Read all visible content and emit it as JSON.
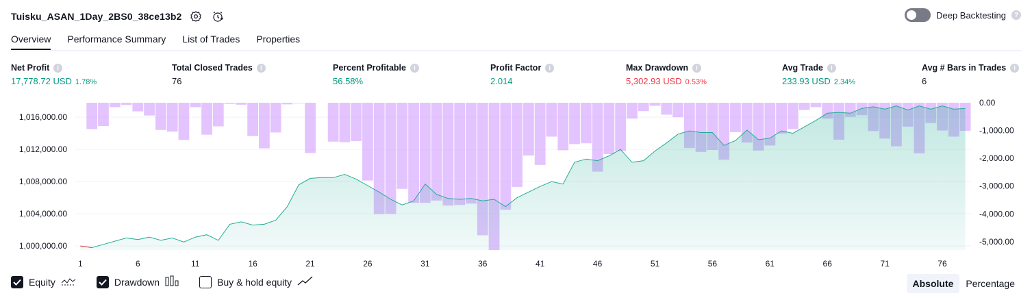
{
  "header": {
    "title": "Tuisku_ASAN_1Day_2BS0_38ce13b2",
    "settings_icon": "gear-icon",
    "alert_icon": "alarm-clock-icon"
  },
  "deep_backtesting": {
    "label": "Deep Backtesting",
    "enabled": false,
    "help": "?"
  },
  "tabs": [
    {
      "label": "Overview",
      "active": true
    },
    {
      "label": "Performance Summary",
      "active": false
    },
    {
      "label": "List of Trades",
      "active": false
    },
    {
      "label": "Properties",
      "active": false
    }
  ],
  "metrics": [
    {
      "label": "Net Profit",
      "value": "17,778.72 USD",
      "pct": "1.78%",
      "color": "#089981"
    },
    {
      "label": "Total Closed Trades",
      "value": "76",
      "pct": "",
      "color": "#131722"
    },
    {
      "label": "Percent Profitable",
      "value": "56.58%",
      "pct": "",
      "color": "#089981"
    },
    {
      "label": "Profit Factor",
      "value": "2.014",
      "pct": "",
      "color": "#089981"
    },
    {
      "label": "Max Drawdown",
      "value": "5,302.93 USD",
      "pct": "0.53%",
      "color": "#f23645"
    },
    {
      "label": "Avg Trade",
      "value": "233.93 USD",
      "pct": "2.34%",
      "color": "#089981"
    },
    {
      "label": "Avg # Bars in Trades",
      "value": "6",
      "pct": "",
      "color": "#131722"
    }
  ],
  "chart_data": {
    "type": "area",
    "x_ticks": [
      1,
      6,
      11,
      16,
      21,
      26,
      31,
      36,
      41,
      46,
      51,
      56,
      61,
      66,
      71,
      76
    ],
    "y_left_ticks": [
      "1,000,000.00",
      "1,004,000.00",
      "1,008,000.00",
      "1,012,000.00",
      "1,016,000.00"
    ],
    "y_left_values": [
      1000000,
      1004000,
      1008000,
      1012000,
      1016000
    ],
    "y_right_ticks": [
      "0.00",
      "-1,000.00",
      "-2,000.00",
      "-3,000.00",
      "-4,000.00",
      "-5,000.00"
    ],
    "y_right_values": [
      0,
      -1000,
      -2000,
      -3000,
      -4000,
      -5000
    ],
    "ylim_left": [
      999500,
      1017800
    ],
    "ylim_right": [
      -5300,
      0
    ],
    "equity": [
      1000000,
      999800,
      1000200,
      1000600,
      1001000,
      1000800,
      1001100,
      1000700,
      1001000,
      1000500,
      1001100,
      1001400,
      1000700,
      1002700,
      1003000,
      1002600,
      1002700,
      1003200,
      1004900,
      1007600,
      1008400,
      1008500,
      1008500,
      1008900,
      1008300,
      1007500,
      1006700,
      1005800,
      1005100,
      1005600,
      1007700,
      1006400,
      1005900,
      1005800,
      1005900,
      1005600,
      1005800,
      1004900,
      1006000,
      1006700,
      1007400,
      1008000,
      1007700,
      1010400,
      1010800,
      1010600,
      1011200,
      1012000,
      1010400,
      1010600,
      1011800,
      1012800,
      1013900,
      1014300,
      1014100,
      1014100,
      1012500,
      1013100,
      1014400,
      1013200,
      1013400,
      1014300,
      1014000,
      1014800,
      1015600,
      1016500,
      1016600,
      1016500,
      1017100,
      1017300,
      1017000,
      1017400,
      1016900,
      1017400,
      1017000,
      1017400,
      1017000,
      1017100
    ],
    "drawdown": [
      0,
      -950,
      -840,
      -160,
      -80,
      -310,
      -460,
      -980,
      -1040,
      -1340,
      -160,
      -1150,
      -850,
      -40,
      -70,
      -1200,
      -1640,
      -1070,
      -60,
      -20,
      -1810,
      0,
      -1400,
      -1420,
      -1380,
      -2800,
      -4010,
      -4000,
      -3100,
      -3600,
      -3600,
      -3520,
      -3700,
      -3680,
      -3630,
      -4770,
      -5300,
      -3850,
      -3030,
      -1900,
      -2240,
      -1220,
      -1710,
      -1490,
      -1460,
      -2480,
      -1850,
      -1740,
      -570,
      -300,
      -110,
      -430,
      -520,
      -1630,
      -1770,
      -1700,
      -2050,
      -1060,
      -1430,
      -1720,
      -1540,
      -1110,
      -950,
      -260,
      -160,
      -570,
      -1330,
      -510,
      -450,
      -1020,
      -1290,
      -1570,
      -860,
      -1820,
      -730,
      -1000,
      -1220,
      -1010
    ]
  },
  "legend": {
    "equity": {
      "label": "Equity",
      "checked": true
    },
    "drawdown": {
      "label": "Drawdown",
      "checked": true
    },
    "buy_hold": {
      "label": "Buy & hold equity",
      "checked": false
    }
  },
  "modes": {
    "absolute": "Absolute",
    "percentage": "Percentage",
    "active": "absolute"
  },
  "colors": {
    "equity_line": "#22ab94",
    "equity_loss": "#f23645",
    "drawdown_bar": "rgba(206,147,255,0.55)",
    "grid": "#f0f3fa"
  }
}
